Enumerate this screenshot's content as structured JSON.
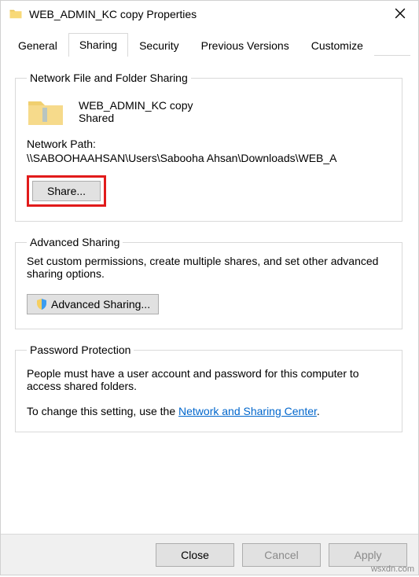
{
  "window": {
    "title": "WEB_ADMIN_KC copy Properties"
  },
  "tabs": {
    "general": "General",
    "sharing": "Sharing",
    "security": "Security",
    "previous": "Previous Versions",
    "customize": "Customize"
  },
  "network_group": {
    "legend": "Network File and Folder Sharing",
    "folder_name": "WEB_ADMIN_KC copy",
    "share_status": "Shared",
    "path_label": "Network Path:",
    "path_value": "\\\\SABOOHAAHSAN\\Users\\Sabooha Ahsan\\Downloads\\WEB_A",
    "share_button": "Share..."
  },
  "advanced_group": {
    "legend": "Advanced Sharing",
    "desc": "Set custom permissions, create multiple shares, and set other advanced sharing options.",
    "button": "Advanced Sharing..."
  },
  "password_group": {
    "legend": "Password Protection",
    "desc": "People must have a user account and password for this computer to access shared folders.",
    "change_prefix": "To change this setting, use the ",
    "link": "Network and Sharing Center",
    "change_suffix": "."
  },
  "footer": {
    "close": "Close",
    "cancel": "Cancel",
    "apply": "Apply"
  },
  "watermark": "wsxdn.com"
}
